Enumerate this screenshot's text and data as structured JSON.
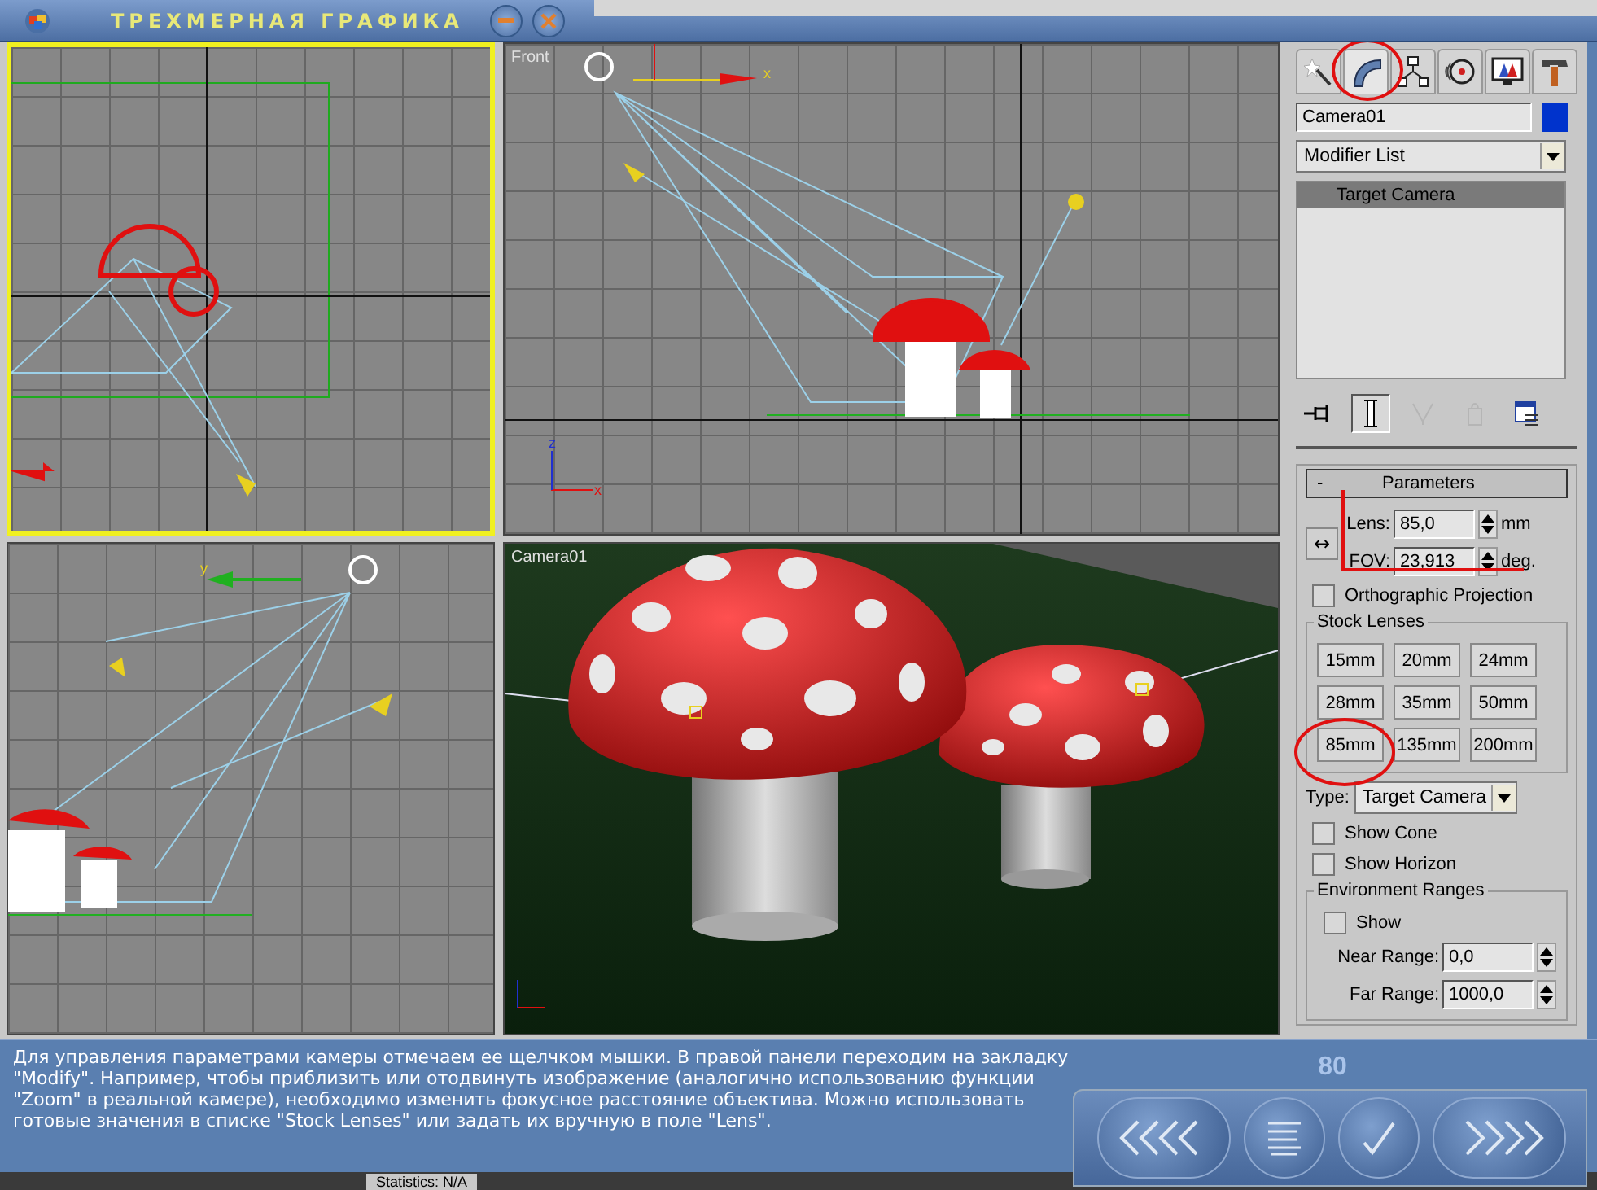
{
  "title_bar": {
    "title": "ТРЕХМЕРНАЯ ГРАФИКА"
  },
  "viewports": [
    {
      "kind": "left",
      "active": true
    },
    {
      "kind": "front",
      "active": false,
      "label": "Front",
      "axis_labels": [
        "x",
        "z",
        "x"
      ]
    },
    {
      "kind": "top",
      "active": false,
      "axis_labels": [
        "y"
      ]
    },
    {
      "kind": "camera",
      "active": false,
      "label": "Camera01"
    }
  ],
  "command_panel": {
    "tabs": [
      {
        "kind": "create",
        "selected": false
      },
      {
        "kind": "modify",
        "selected": true
      },
      {
        "kind": "hierarchy",
        "selected": false
      },
      {
        "kind": "motion",
        "selected": false
      },
      {
        "kind": "display",
        "selected": false
      },
      {
        "kind": "utilities",
        "selected": false
      }
    ],
    "object_name": "Camera01",
    "modifier_list": "Modifier List",
    "stack": [
      {
        "label": "Target Camera",
        "selected": true
      }
    ],
    "stack_tools": [
      {
        "kind": "pin",
        "pressed": false,
        "disabled": false
      },
      {
        "kind": "end_result",
        "pressed": true,
        "disabled": false
      },
      {
        "kind": "unique",
        "pressed": false,
        "disabled": true
      },
      {
        "kind": "remove",
        "pressed": false,
        "disabled": true
      },
      {
        "kind": "configure",
        "pressed": false,
        "disabled": false
      }
    ],
    "rollout": {
      "collapse": "-",
      "title": "Parameters"
    },
    "lens": {
      "label": "Lens:",
      "value": "85,0",
      "unit": "mm"
    },
    "fov": {
      "direction": "↔",
      "label": "FOV:",
      "value": "23,913",
      "unit": "deg."
    },
    "orthographic": {
      "label": "Orthographic Projection",
      "checked": false
    },
    "stock_lenses": {
      "title": "Stock Lenses",
      "buttons": [
        "15mm",
        "20mm",
        "24mm",
        "28mm",
        "35mm",
        "50mm",
        "85mm",
        "135mm",
        "200mm"
      ]
    },
    "type": {
      "label": "Type:",
      "value": "Target Camera"
    },
    "show_cone": {
      "label": "Show Cone",
      "checked": false
    },
    "show_horizon": {
      "label": "Show Horizon",
      "checked": false
    },
    "environment": {
      "title": "Environment Ranges",
      "show": {
        "label": "Show",
        "checked": false
      },
      "near": {
        "label": "Near Range:",
        "value": "0,0"
      },
      "far": {
        "label": "Far Range:",
        "value": "1000,0"
      }
    }
  },
  "description": "Для управления параметрами камеры отмечаем ее щелчком мышки. В правой панели переходим на закладку \"Modify\". Например, чтобы приблизить или отодвинуть изображение (аналогично использованию функции \"Zoom\" в реальной камере), необходимо изменить фокусное расстояние объектива. Можно использовать готовые значения в списке \"Stock Lenses\" или задать их вручную в поле \"Lens\".",
  "page_number": "80",
  "nav_buttons": [
    {
      "kind": "back"
    },
    {
      "kind": "contents"
    },
    {
      "kind": "check"
    },
    {
      "kind": "forward"
    }
  ],
  "status": "Statistics: N/A"
}
